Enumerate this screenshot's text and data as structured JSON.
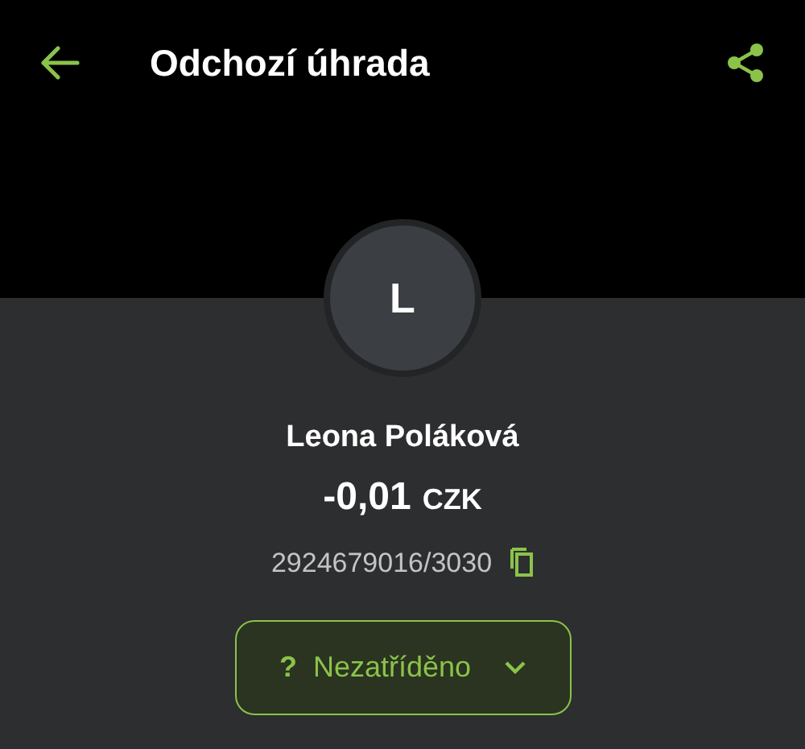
{
  "header": {
    "title": "Odchozí úhrada"
  },
  "avatar": {
    "initial": "L"
  },
  "payee": {
    "name": "Leona Poláková",
    "amount": "-0,01",
    "currency": "CZK",
    "account": "2924679016/3030"
  },
  "category_button": {
    "icon": "?",
    "label": "Nezatříděno"
  }
}
